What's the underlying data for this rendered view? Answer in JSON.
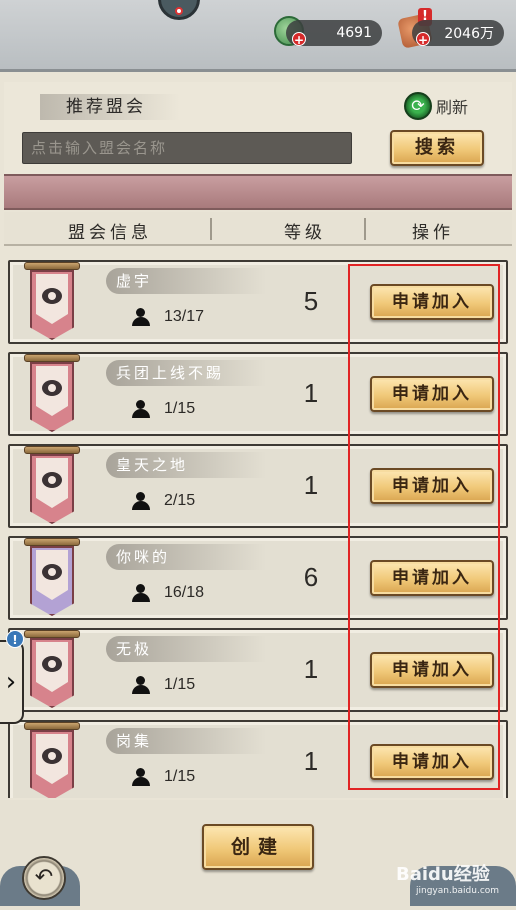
{
  "currencies": {
    "jade": "4691",
    "coin": "2046万"
  },
  "recommend": {
    "title": "推荐盟会",
    "refresh_label": "刷新",
    "search_placeholder": "点击输入盟会名称",
    "search_button": "搜索"
  },
  "table": {
    "col_info": "盟会信息",
    "col_level": "等级",
    "col_action": "操作"
  },
  "guilds": [
    {
      "name": "虚宇",
      "members": "13/17",
      "level": "5",
      "action": "申请加入",
      "banner": "pink"
    },
    {
      "name": "兵团上线不踢",
      "members": "1/15",
      "level": "1",
      "action": "申请加入",
      "banner": "pink"
    },
    {
      "name": "皇天之地",
      "members": "2/15",
      "level": "1",
      "action": "申请加入",
      "banner": "pink"
    },
    {
      "name": "你咪的",
      "members": "16/18",
      "level": "6",
      "action": "申请加入",
      "banner": "purple"
    },
    {
      "name": "无极",
      "members": "1/15",
      "level": "1",
      "action": "申请加入",
      "banner": "pink"
    },
    {
      "name": "岗集",
      "members": "1/15",
      "level": "1",
      "action": "申请加入",
      "banner": "pink"
    }
  ],
  "footer": {
    "create_button": "创建"
  },
  "watermark": {
    "brand": "Baidu经验",
    "url": "jingyan.baidu.com"
  },
  "colors": {
    "highlight": "#e12424",
    "button_gold": "#f0c878",
    "band": "#b08486"
  }
}
